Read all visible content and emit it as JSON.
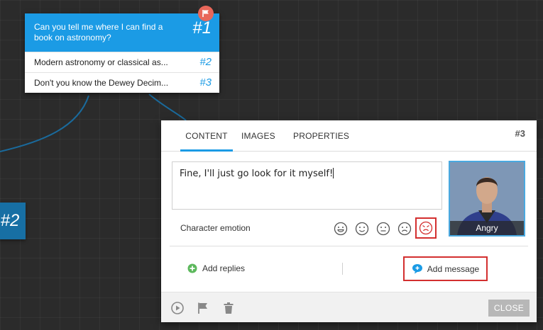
{
  "node": {
    "question": "Can you tell me where I can find a book on astronomy?",
    "question_num": "#1",
    "replies": [
      {
        "text": "Modern astronomy or classical as...",
        "num": "#2"
      },
      {
        "text": "Don't you know the Dewey Decim...",
        "num": "#3"
      }
    ]
  },
  "side_node": {
    "num": "#2"
  },
  "panel": {
    "tabs": [
      "CONTENT",
      "IMAGES",
      "PROPERTIES"
    ],
    "active_tab": "CONTENT",
    "number": "#3",
    "message": "Fine, I'll just go look for it myself!",
    "emotion_label": "Character emotion",
    "emotions": [
      "very-happy",
      "happy",
      "neutral",
      "sad",
      "angry"
    ],
    "selected_emotion": "angry",
    "portrait_caption": "Angry",
    "add_replies_label": "Add replies",
    "add_message_label": "Add message",
    "close_label": "CLOSE"
  },
  "colors": {
    "accent": "#1b9be5",
    "flag": "#e8675a",
    "highlight": "#d32f2f",
    "canvas": "#2b2b2b"
  }
}
